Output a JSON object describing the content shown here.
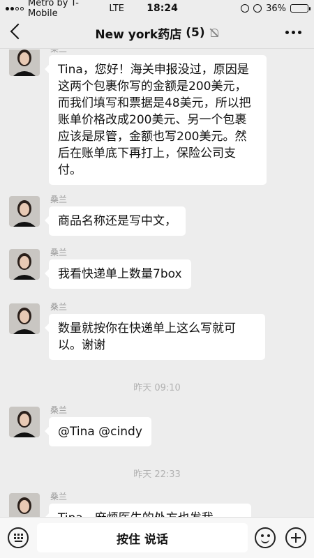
{
  "status_bar": {
    "carrier": "Metro by T-Mobile",
    "network": "LTE",
    "time": "18:24",
    "battery": "36%",
    "battery_level": 0.36
  },
  "nav": {
    "title": "New york药店",
    "member_count": "(5)"
  },
  "messages": [
    {
      "sender": "桑兰",
      "text": "Tina，您好！海关申报没过，原因是这两个包裹你写的金额是200美元，而我们填写和票据是48美元，所以把账单价格改成200美元、另一个包裹应该是尿管，金额也写200美元。然后在账单底下再打上，保险公司支付。"
    },
    {
      "sender": "桑兰",
      "text": "商品名称还是写中文，"
    },
    {
      "sender": "桑兰",
      "text": "我看快递单上数量7box"
    },
    {
      "sender": "桑兰",
      "text": "数量就按你在快递单上这么写就可以。谢谢"
    },
    {
      "sender": "桑兰",
      "text": "@Tina @cindy"
    },
    {
      "sender": "桑兰",
      "text": "Tina，麻烦医生的处方也发我"
    }
  ],
  "time_dividers": [
    "昨天 09:10",
    "昨天 22:33"
  ],
  "input_bar": {
    "hold_to_talk": "按住 说话"
  }
}
